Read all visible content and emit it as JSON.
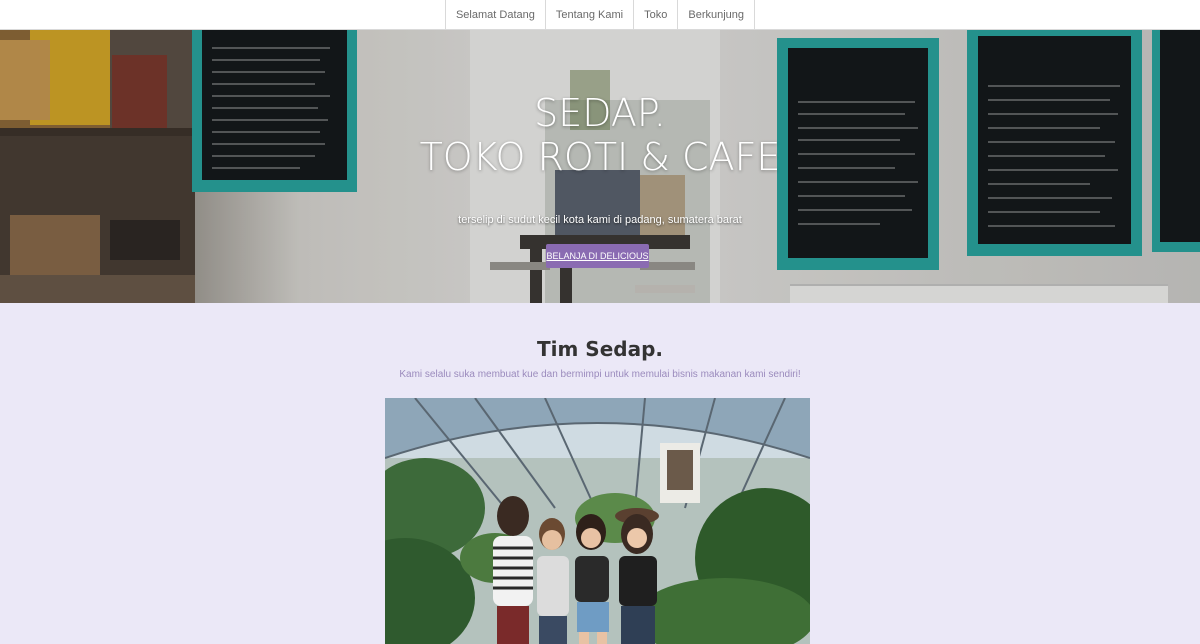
{
  "nav": {
    "items": [
      {
        "label": "Selamat Datang"
      },
      {
        "label": "Tentang Kami"
      },
      {
        "label": "Toko"
      },
      {
        "label": "Berkunjung"
      }
    ]
  },
  "hero": {
    "title_line1": "SEDAP.",
    "title_line2": "TOKO ROTI & CAFE",
    "subtitle": "terselip di sudut kecil  kota kami di padang, sumatera barat",
    "cta_label": "BELANJA DI DELICIOUS"
  },
  "team": {
    "title": "Tim Sedap.",
    "subtitle": "Kami selalu suka membuat kue dan bermimpi untuk memulai bisnis makanan kami sendiri!"
  },
  "colors": {
    "accent": "#8a6bb2",
    "section_bg": "#ebe8f7",
    "subtitle_text": "#9b8bbd"
  },
  "icons": {
    "hero_image": "cafe-interior-photo",
    "team_image": "team-greenhouse-photo"
  }
}
